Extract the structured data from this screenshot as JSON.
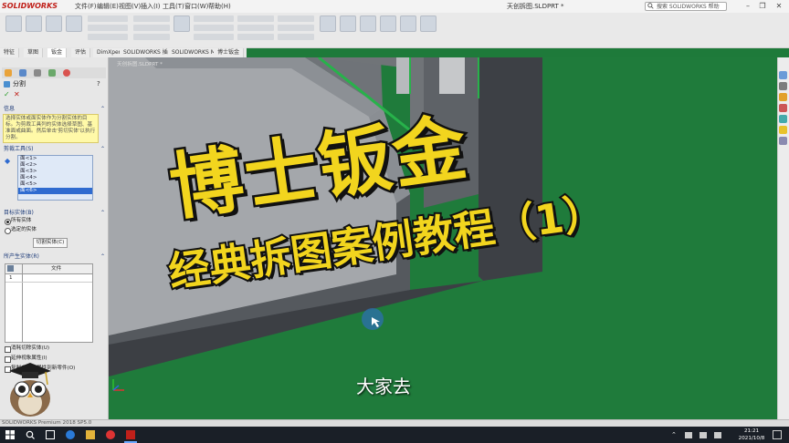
{
  "app": {
    "logo_text": "SOLIDWORKS",
    "document_title": "天创拆图.SLDPRT *",
    "menus": [
      "文件(F)",
      "编辑(E)",
      "视图(V)",
      "插入(I)",
      "工具(T)",
      "窗口(W)",
      "帮助(H)"
    ],
    "search_placeholder": "搜索 SOLIDWORKS 帮助"
  },
  "tabs": [
    "特征",
    "草图",
    "钣金",
    "评估",
    "DimXpert",
    "SOLIDWORKS 插件",
    "SOLIDWORKS MBD",
    "博士钣金"
  ],
  "active_tab_index": 2,
  "property_manager": {
    "title": "分割",
    "info_header": "信息",
    "info_text": "选择实体或面实体作为分割实体的目标。为剪裁工具列的实体选择草图、基准面或曲面。然后单击'剪切实体'以执行分割。",
    "trim_tools_header": "剪裁工具(S)",
    "faces": [
      "面<1>",
      "面<2>",
      "面<3>",
      "面<4>",
      "面<5>",
      "面<6>"
    ],
    "selected_face_index": 5,
    "target_bodies_header": "目标实体(B)",
    "target_options": [
      "所有实体",
      "选定的实体"
    ],
    "target_selected_index": 0,
    "cut_button": "切割实体(C)",
    "result_bodies_header": "所产生实体(R)",
    "result_table": {
      "columns": [
        "",
        "文件"
      ],
      "rows": [
        [
          "1",
          ""
        ]
      ]
    },
    "checkboxes": [
      "消耗切除实体(U)",
      "延伸视象属性(I)",
      "复制自定义属性到新零件(O)"
    ]
  },
  "overlay": {
    "title_main": "博士钣金",
    "title_sub": "经典拆图案例教程（1）",
    "subtitle": "大家去"
  },
  "status": {
    "text": "SOLIDWORKS Premium 2018 SP5.0"
  },
  "clock": {
    "time": "21:21",
    "date": "2021/10/8"
  },
  "colors": {
    "viewport_green": "#1f7b3b",
    "title_yellow": "#f2d51e",
    "selection_blue": "#2f6bd0",
    "info_yellow": "#fff9a8"
  }
}
